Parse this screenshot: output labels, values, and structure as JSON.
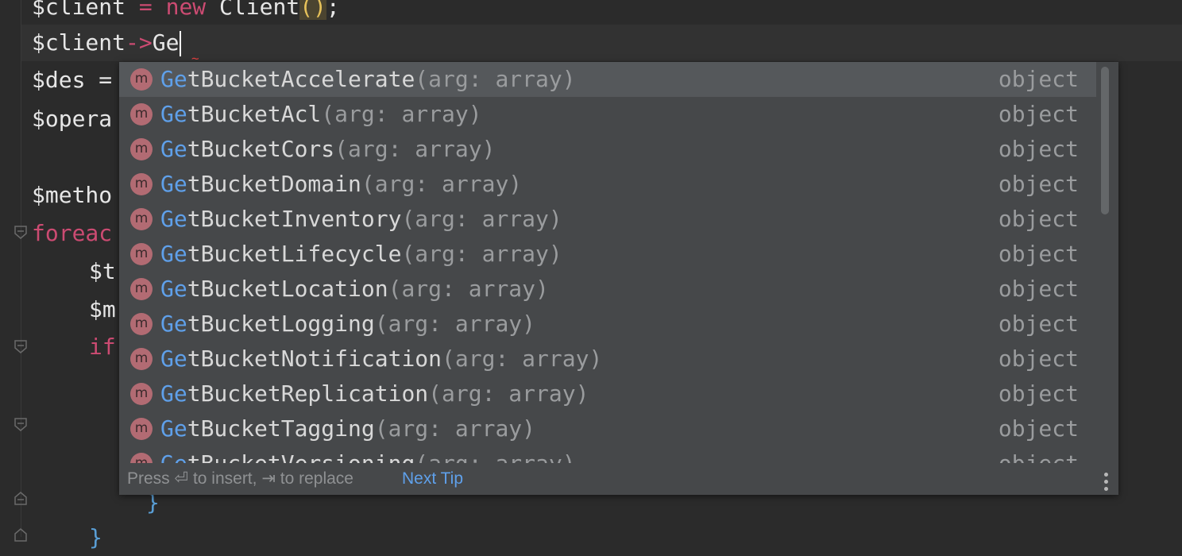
{
  "editor": {
    "lines": {
      "l1": {
        "var": "$client",
        "eq": " = ",
        "kw": "new",
        "cls": " Client",
        "paren": "()",
        "semi": ";"
      },
      "l2": {
        "var": "$client",
        "arrow": "->",
        "typed": "Ge"
      },
      "l3": "$des = ",
      "l4": "$opera",
      "l5": "$metho",
      "l6": "foreac",
      "l7": "$t",
      "l8": "$m",
      "l9": "if",
      "l10": "}",
      "l11": "}"
    }
  },
  "completion": {
    "items": [
      {
        "match": "Ge",
        "rest": "tBucketAccelerate",
        "sig": "(arg: array)",
        "type": "object",
        "icon": "m"
      },
      {
        "match": "Ge",
        "rest": "tBucketAcl",
        "sig": "(arg: array)",
        "type": "object",
        "icon": "m"
      },
      {
        "match": "Ge",
        "rest": "tBucketCors",
        "sig": "(arg: array)",
        "type": "object",
        "icon": "m"
      },
      {
        "match": "Ge",
        "rest": "tBucketDomain",
        "sig": "(arg: array)",
        "type": "object",
        "icon": "m"
      },
      {
        "match": "Ge",
        "rest": "tBucketInventory",
        "sig": "(arg: array)",
        "type": "object",
        "icon": "m"
      },
      {
        "match": "Ge",
        "rest": "tBucketLifecycle",
        "sig": "(arg: array)",
        "type": "object",
        "icon": "m"
      },
      {
        "match": "Ge",
        "rest": "tBucketLocation",
        "sig": "(arg: array)",
        "type": "object",
        "icon": "m"
      },
      {
        "match": "Ge",
        "rest": "tBucketLogging",
        "sig": "(arg: array)",
        "type": "object",
        "icon": "m"
      },
      {
        "match": "Ge",
        "rest": "tBucketNotification",
        "sig": "(arg: array)",
        "type": "object",
        "icon": "m"
      },
      {
        "match": "Ge",
        "rest": "tBucketReplication",
        "sig": "(arg: array)",
        "type": "object",
        "icon": "m"
      },
      {
        "match": "Ge",
        "rest": "tBucketTagging",
        "sig": "(arg: array)",
        "type": "object",
        "icon": "m"
      },
      {
        "match": "Ge",
        "rest": "tBucketVersioning",
        "sig": "(arg: array)",
        "type": "object",
        "icon": "m"
      }
    ],
    "selected_index": 0,
    "footer": {
      "hint": "Press ⏎ to insert, ⇥ to replace",
      "next_tip": "Next Tip"
    }
  },
  "colors": {
    "background": "#2b2b2b",
    "popup": "#46484a",
    "match_highlight": "#5fa0ea",
    "keyword": "#cc4b72",
    "method_icon": "#b26b73"
  }
}
